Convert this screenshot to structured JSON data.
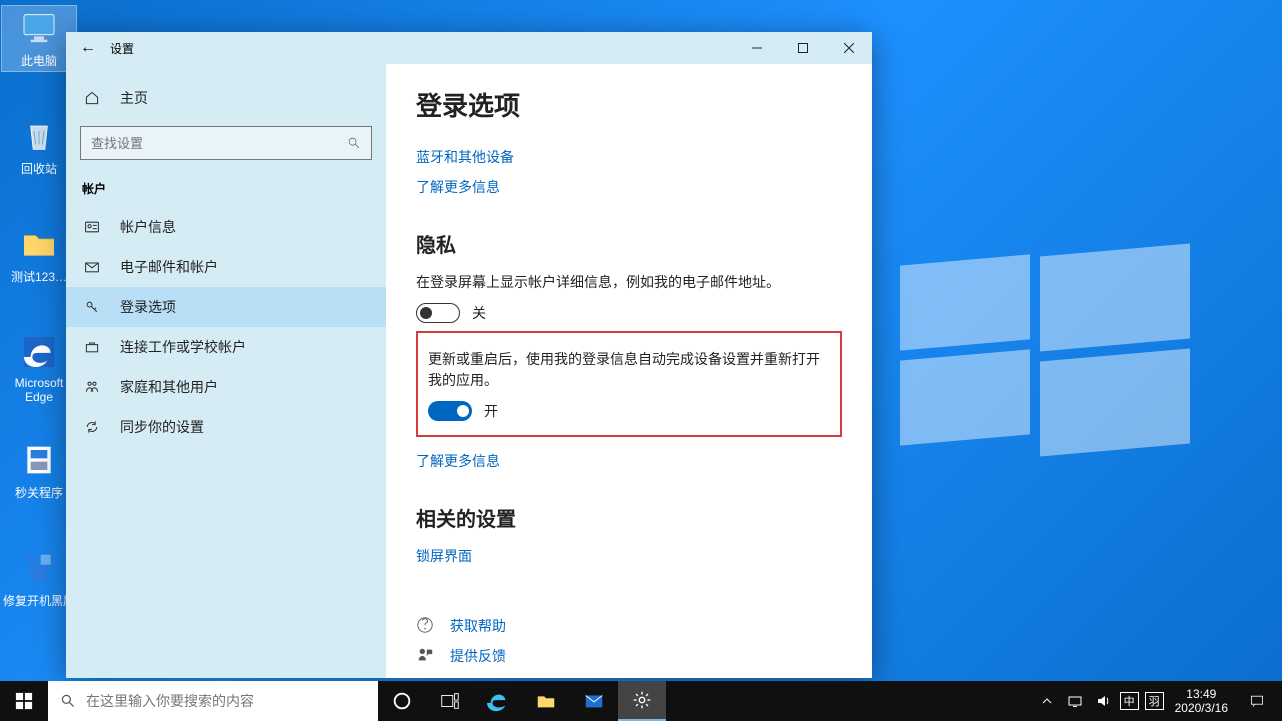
{
  "desktop_icons": [
    {
      "label": "此电脑",
      "kind": "pc"
    },
    {
      "label": "回收站",
      "kind": "bin"
    },
    {
      "label": "测试123…",
      "kind": "folder"
    },
    {
      "label": "Microsoft Edge",
      "kind": "edge"
    },
    {
      "label": "秒关程序",
      "kind": "app"
    },
    {
      "label": "修复开机黑屏",
      "kind": "fix"
    }
  ],
  "settings": {
    "window_title": "设置",
    "sidebar": {
      "home": "主页",
      "search_placeholder": "查找设置",
      "category": "帐户",
      "items": [
        {
          "icon": "person",
          "label": "帐户信息"
        },
        {
          "icon": "mail",
          "label": "电子邮件和帐户"
        },
        {
          "icon": "key",
          "label": "登录选项"
        },
        {
          "icon": "briefcase",
          "label": "连接工作或学校帐户"
        },
        {
          "icon": "family",
          "label": "家庭和其他用户"
        },
        {
          "icon": "sync",
          "label": "同步你的设置"
        }
      ],
      "active_index": 2
    },
    "content": {
      "title": "登录选项",
      "link_bluetooth": "蓝牙和其他设备",
      "link_more1": "了解更多信息",
      "privacy_heading": "隐私",
      "privacy_desc1": "在登录屏幕上显示帐户详细信息，例如我的电子邮件地址。",
      "toggle1_state": "off",
      "toggle1_label": "关",
      "highlight_desc": "更新或重启后，使用我的登录信息自动完成设备设置并重新打开我的应用。",
      "toggle2_state": "on",
      "toggle2_label": "开",
      "link_more2": "了解更多信息",
      "related_heading": "相关的设置",
      "link_lockscreen": "锁屏界面",
      "help_label": "获取帮助",
      "feedback_label": "提供反馈"
    }
  },
  "taskbar": {
    "search_placeholder": "在这里输入你要搜索的内容",
    "ime1": "中",
    "ime2": "羽",
    "time": "13:49",
    "date": "2020/3/16"
  }
}
